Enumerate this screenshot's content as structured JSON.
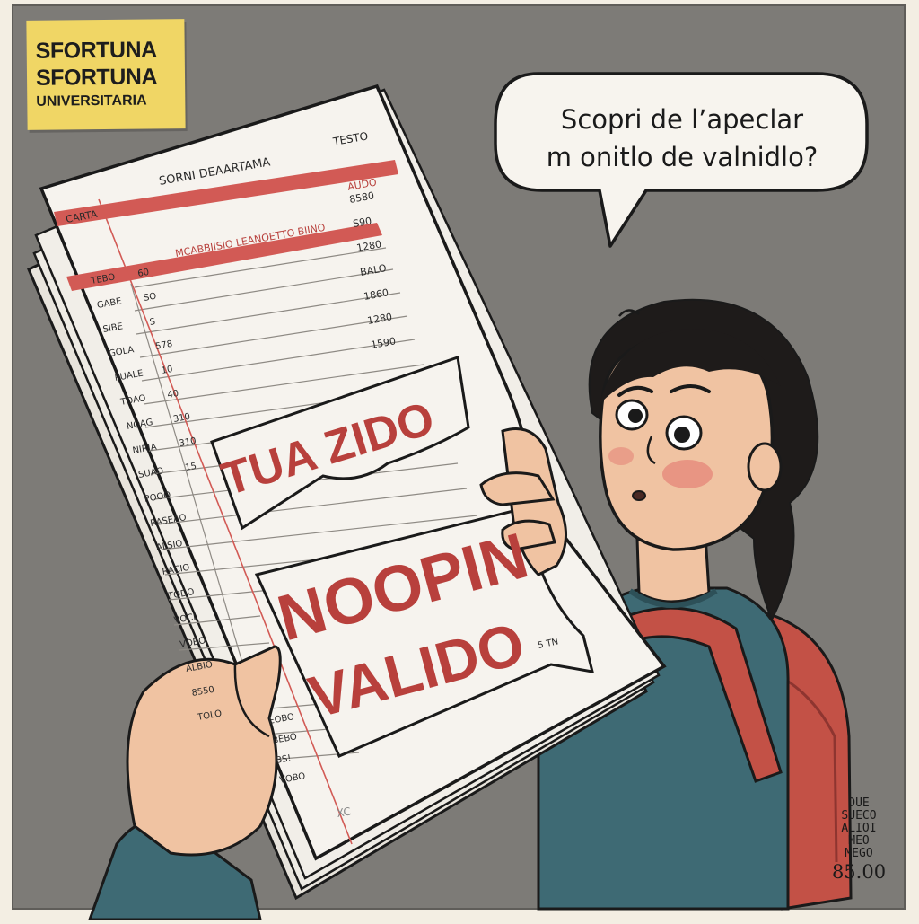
{
  "badge": {
    "line1": "SFORTUNA",
    "line2": "SFORTUNA",
    "line3": "UNIVERSITARIA"
  },
  "speech_bubble": {
    "line1": "Scopri de l’apeclar",
    "line2": "m onitlo de valnidlo?"
  },
  "document": {
    "header_title": "SORNI DEAARTAMA",
    "header_right": "TESTO",
    "left_label": "CARTA",
    "col_header": "MCABBIISIO LEANOETTO BIINO",
    "col_right": "AUDO",
    "rows": [
      {
        "label": "TEBO",
        "value": "60"
      },
      {
        "label": "GABE",
        "value": "SO"
      },
      {
        "label": "SIBE",
        "value": "S"
      },
      {
        "label": "GOLA",
        "value": "578"
      },
      {
        "label": "PUALE",
        "value": "10"
      },
      {
        "label": "TOAO",
        "value": "40"
      },
      {
        "label": "NOAG",
        "value": "310"
      },
      {
        "label": "NIRIA",
        "value": "310"
      },
      {
        "label": "SUAO",
        "value": "15"
      },
      {
        "label": "POOO",
        "value": ""
      },
      {
        "label": "RASEAO",
        "value": ""
      },
      {
        "label": "ALSIO",
        "value": ""
      },
      {
        "label": "RACIO",
        "value": ""
      },
      {
        "label": "TODO",
        "value": ""
      },
      {
        "label": "VOCI",
        "value": ""
      },
      {
        "label": "VOBO",
        "value": ""
      },
      {
        "label": "ALBIO",
        "value": ""
      },
      {
        "label": "8550",
        "value": ""
      },
      {
        "label": "TOLO",
        "value": ""
      }
    ],
    "right_values": [
      "8580",
      "S90",
      "1280",
      "BALO",
      "1860",
      "1280",
      "1590"
    ],
    "lower_rows": [
      "EOBO",
      "BEBO",
      "BS!",
      "VOBO"
    ],
    "footer_mark": "XC",
    "stamp1": "TUA ZIDO",
    "stamp2_line1": "NOOPIN",
    "stamp2_line2": "VALIDO",
    "stamp2_small": "5 TN"
  },
  "corner_note": {
    "line1": "DUE",
    "line2": "SUECO",
    "line3": "ALIOI",
    "line4": "MEO",
    "line5": "MEGO",
    "price": "85.00"
  },
  "colors": {
    "background": "#7d7b77",
    "stamp_red": "#b8403c",
    "sweater": "#3e6a74",
    "backpack": "#c35146",
    "skin": "#f0c3a2",
    "badge": "#f0d665"
  }
}
